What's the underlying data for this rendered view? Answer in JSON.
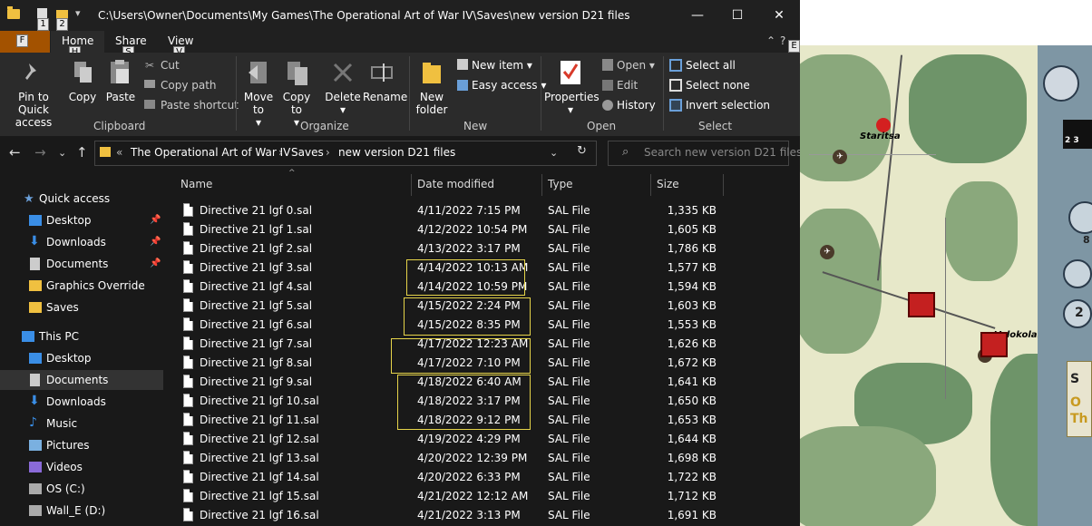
{
  "window": {
    "title": "C:\\Users\\Owner\\Documents\\My Games\\The Operational Art of War IV\\Saves\\new version D21 files",
    "minimize": "—",
    "maximize": "☐",
    "close": "✕",
    "quick_access_keys": [
      "1",
      "2"
    ],
    "qa_dropdown": "▾"
  },
  "tabs": {
    "file": "F",
    "home": "Home",
    "home_key": "H",
    "share": "Share",
    "share_key": "S",
    "view": "View",
    "view_key": "V",
    "help_key": "E"
  },
  "ribbon": {
    "clipboard": {
      "label": "Clipboard",
      "pin": "Pin to Quick access",
      "copy": "Copy",
      "paste": "Paste",
      "cut": "Cut",
      "copy_path": "Copy path",
      "paste_shortcut": "Paste shortcut"
    },
    "organize": {
      "label": "Organize",
      "move_to": "Move to",
      "copy_to": "Copy to",
      "delete": "Delete",
      "rename": "Rename"
    },
    "new": {
      "label": "New",
      "new_folder": "New folder",
      "new_item": "New item",
      "easy_access": "Easy access"
    },
    "open": {
      "label": "Open",
      "properties": "Properties",
      "open": "Open",
      "edit": "Edit",
      "history": "History"
    },
    "select": {
      "label": "Select",
      "select_all": "Select all",
      "select_none": "Select none",
      "invert": "Invert selection"
    }
  },
  "address": {
    "overflow": "«",
    "crumbs": [
      "The Operational Art of War IV",
      "Saves",
      "new version D21 files"
    ],
    "search_placeholder": "Search new version D21 files"
  },
  "nav": {
    "quick_access": "Quick access",
    "desktop": "Desktop",
    "downloads": "Downloads",
    "documents": "Documents",
    "graphics_override": "Graphics Override",
    "saves": "Saves",
    "this_pc": "This PC",
    "pc_desktop": "Desktop",
    "pc_documents": "Documents",
    "pc_downloads": "Downloads",
    "music": "Music",
    "pictures": "Pictures",
    "videos": "Videos",
    "os_c": "OS (C:)",
    "wall_e": "Wall_E (D:)"
  },
  "columns": {
    "name": "Name",
    "date": "Date modified",
    "type": "Type",
    "size": "Size"
  },
  "files": [
    {
      "name": "Directive 21 lgf 0.sal",
      "date": "4/11/2022 7:15 PM",
      "type": "SAL File",
      "size": "1,335 KB"
    },
    {
      "name": "Directive 21 lgf 1.sal",
      "date": "4/12/2022 10:54 PM",
      "type": "SAL File",
      "size": "1,605 KB"
    },
    {
      "name": "Directive 21 lgf 2.sal",
      "date": "4/13/2022 3:17 PM",
      "type": "SAL File",
      "size": "1,786 KB"
    },
    {
      "name": "Directive 21 lgf 3.sal",
      "date": "4/14/2022 10:13 AM",
      "type": "SAL File",
      "size": "1,577 KB"
    },
    {
      "name": "Directive 21 lgf 4.sal",
      "date": "4/14/2022 10:59 PM",
      "type": "SAL File",
      "size": "1,594 KB"
    },
    {
      "name": "Directive 21 lgf 5.sal",
      "date": "4/15/2022 2:24 PM",
      "type": "SAL File",
      "size": "1,603 KB"
    },
    {
      "name": "Directive 21 lgf 6.sal",
      "date": "4/15/2022 8:35 PM",
      "type": "SAL File",
      "size": "1,553 KB"
    },
    {
      "name": "Directive 21 lgf 7.sal",
      "date": "4/17/2022 12:23 AM",
      "type": "SAL File",
      "size": "1,626 KB"
    },
    {
      "name": "Directive 21 lgf 8.sal",
      "date": "4/17/2022 7:10 PM",
      "type": "SAL File",
      "size": "1,672 KB"
    },
    {
      "name": "Directive 21 lgf 9.sal",
      "date": "4/18/2022 6:40 AM",
      "type": "SAL File",
      "size": "1,641 KB"
    },
    {
      "name": "Directive 21 lgf 10.sal",
      "date": "4/18/2022 3:17 PM",
      "type": "SAL File",
      "size": "1,650 KB"
    },
    {
      "name": "Directive 21 lgf 11.sal",
      "date": "4/18/2022 9:12 PM",
      "type": "SAL File",
      "size": "1,653 KB"
    },
    {
      "name": "Directive 21 lgf 12.sal",
      "date": "4/19/2022 4:29 PM",
      "type": "SAL File",
      "size": "1,644 KB"
    },
    {
      "name": "Directive 21 lgf 13.sal",
      "date": "4/20/2022 12:39 PM",
      "type": "SAL File",
      "size": "1,698 KB"
    },
    {
      "name": "Directive 21 lgf 14.sal",
      "date": "4/20/2022 6:33 PM",
      "type": "SAL File",
      "size": "1,722 KB"
    },
    {
      "name": "Directive 21 lgf 15.sal",
      "date": "4/21/2022 12:12 AM",
      "type": "SAL File",
      "size": "1,712 KB"
    },
    {
      "name": "Directive 21 lgf 16.sal",
      "date": "4/21/2022 3:13 PM",
      "type": "SAL File",
      "size": "1,691 KB"
    }
  ],
  "map": {
    "town_staritsa": "Staritsa",
    "town_volokolamsk": "Volokolamsk",
    "panel_num_8": "8",
    "panel_num_2": "2",
    "panel_s": "S",
    "panel_o": "O",
    "panel_t": "Th",
    "counter_nums": "2 3"
  },
  "colors": {
    "accent_file_tab": "#a35200",
    "highlight_box": "#e6d44a",
    "selected_nav": "#333333"
  }
}
